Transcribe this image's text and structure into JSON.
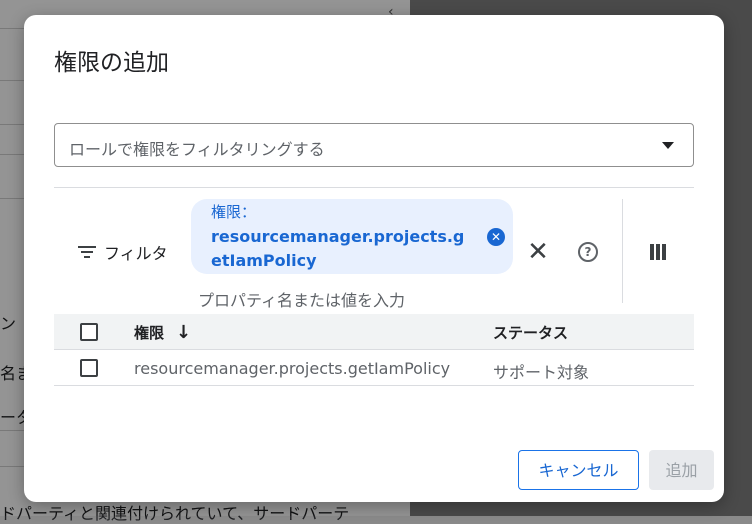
{
  "background": {
    "partial_texts": [
      "ン",
      "名ま",
      "ータ",
      "ドパーティと関連付けられていて、サードパーテ"
    ]
  },
  "dialog": {
    "title": "権限の追加",
    "role_filter": {
      "placeholder": "ロールで権限をフィルタリングする"
    },
    "filter_bar": {
      "label": "フィルタ",
      "chip": {
        "key": "権限：",
        "value": "resourcemanager.projects.getIamPolicy"
      },
      "input_placeholder": "プロパティ名または値を入力"
    },
    "table": {
      "headers": {
        "permission": "権限",
        "status": "ステータス"
      },
      "sort_indicator": "↓",
      "rows": [
        {
          "permission": "resourcemanager.projects.getIamPolicy",
          "status": "サポート対象"
        }
      ]
    },
    "actions": {
      "cancel": "キャンセル",
      "add": "追加"
    }
  },
  "icons": {
    "filter": "filter-list-icon",
    "chip_remove": "cancel-circle-icon",
    "clear": "close-icon",
    "help": "help-circle-icon",
    "columns": "view-column-icon",
    "dropdown": "arrow-drop-down-icon",
    "sort": "arrow-downward-icon"
  },
  "colors": {
    "accent": "#1967d2",
    "chip_bg": "#e8f0fe",
    "disabled_bg": "#e8eaed",
    "disabled_text": "#9aa0a6"
  }
}
